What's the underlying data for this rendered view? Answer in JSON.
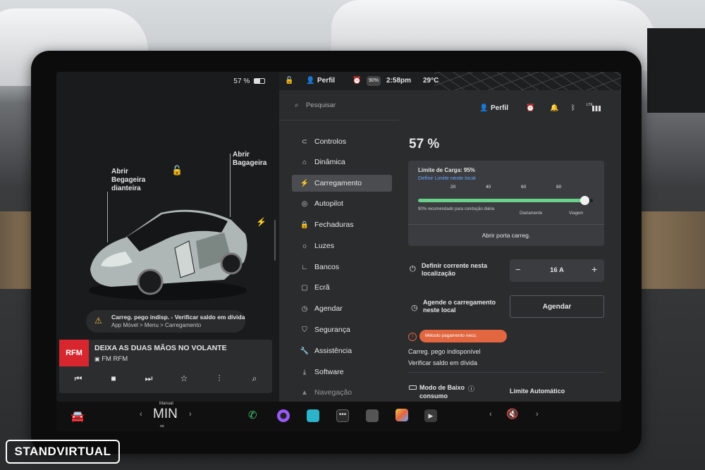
{
  "status": {
    "battery_pct": "57 %",
    "profile": "Perfil",
    "time": "2:58pm",
    "temperature": "29°C",
    "charge_badge": "90%"
  },
  "car_panel": {
    "frunk_label": "Abrir\nBegageira\ndianteira",
    "trunk_label": "Abrir\nBagageira",
    "alert_title": "Carreg. pego indisp. - Verificar saldo em dívida",
    "alert_sub": "App Móvel > Menu > Carregamento"
  },
  "media": {
    "title": "DEIXA AS DUAS MÃOS NO VOLANTE",
    "station": "FM RFM",
    "logo": "RFM"
  },
  "search": {
    "placeholder": "Pesquisar"
  },
  "header_right": {
    "profile": "Perfil",
    "signal_label": "LTE"
  },
  "nav": [
    {
      "label": "Controlos",
      "icon": "toggle-icon"
    },
    {
      "label": "Dinâmica",
      "icon": "car-icon"
    },
    {
      "label": "Carregamento",
      "icon": "bolt-icon"
    },
    {
      "label": "Autopilot",
      "icon": "steering-icon"
    },
    {
      "label": "Fechaduras",
      "icon": "lock-icon"
    },
    {
      "label": "Luzes",
      "icon": "sun-icon"
    },
    {
      "label": "Bancos",
      "icon": "seat-icon"
    },
    {
      "label": "Ecrã",
      "icon": "screen-icon"
    },
    {
      "label": "Agendar",
      "icon": "clock-icon"
    },
    {
      "label": "Segurança",
      "icon": "shield-icon"
    },
    {
      "label": "Assistência",
      "icon": "wrench-icon"
    },
    {
      "label": "Software",
      "icon": "download-icon"
    },
    {
      "label": "Navegação",
      "icon": "navigation-icon"
    }
  ],
  "charging": {
    "battery": "57 %",
    "limit_label": "Limite de Carga: 95%",
    "limit_link": "Definir Limite neste local",
    "ticks": [
      "20",
      "40",
      "60",
      "80"
    ],
    "limit_fraction": 0.95,
    "recommended_text": "90% recomendado para condução diária",
    "daily_label": "Diariamente",
    "trip_label": "Viagem",
    "open_port": "Abrir porta carreg.",
    "current_label": "Definir corrente nesta localização",
    "current_value": "16 A",
    "minus": "−",
    "plus": "+",
    "schedule_label": "Agende o carregamento neste local",
    "schedule_button": "Agendar",
    "error_pill": "Método pagamento neco.",
    "unavailable": "Carreg. pego indisponível",
    "check_debt": "Verificar saldo em dívida",
    "low_mode": "Modo de Baixo",
    "low_mode_sub": "consumo",
    "auto_limit": "Limite Automático"
  },
  "dock": {
    "mode_small": "Manual",
    "mode": "MIN"
  },
  "watermark": "STANDVIRTUAL",
  "colors": {
    "accent_green": "#6ad08a",
    "error_orange": "#e2663f",
    "link_blue": "#6aa6ff"
  }
}
